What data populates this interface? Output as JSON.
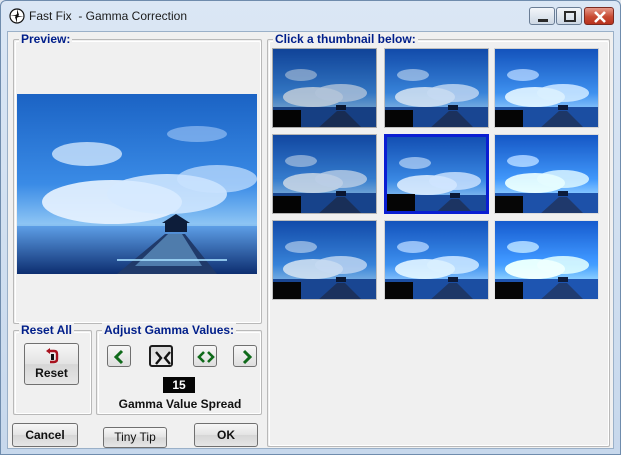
{
  "window": {
    "title": "Fast Fix  - Gamma Correction",
    "icons": {
      "app": "aperture-icon",
      "minimize": "minimize-icon",
      "maximize": "maximize-icon",
      "close": "close-icon"
    }
  },
  "preview": {
    "legend": "Preview:"
  },
  "thumbnails": {
    "legend": "Click a thumbnail below:",
    "selected_index": 4,
    "brightness": [
      0.85,
      0.95,
      1.05,
      0.9,
      1.0,
      1.1,
      0.95,
      1.05,
      1.15
    ]
  },
  "reset_group": {
    "legend": "Reset All",
    "button_label": "Reset",
    "button_icon": "reset-icon"
  },
  "gamma_group": {
    "legend": "Adjust Gamma Values:",
    "buttons": [
      {
        "icon": "arrow-left-icon"
      },
      {
        "icon": "arrows-inward-icon",
        "pressed": true
      },
      {
        "icon": "arrows-outward-icon"
      },
      {
        "icon": "arrow-right-icon"
      }
    ],
    "spread_value": "15",
    "spread_label": "Gamma Value Spread"
  },
  "footer": {
    "cancel_label": "Cancel",
    "tiny_tip_label": "Tiny Tip",
    "ok_label": "OK"
  },
  "colors": {
    "legend_text": "#001e8a",
    "selection_border": "#0a1ed2",
    "spread_bg": "#050505"
  }
}
